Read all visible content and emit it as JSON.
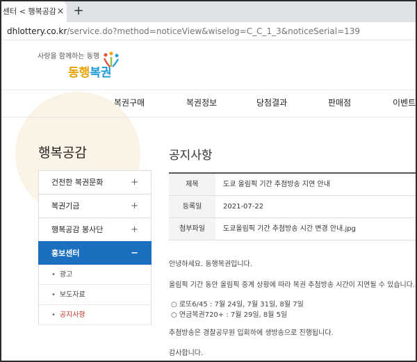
{
  "browser": {
    "tab_title": "센터 < 행복공감",
    "tab_close": "×",
    "new_tab": "+",
    "url_host": "dhlottery.co.kr",
    "url_path": "/service.do?method=noticeView&wiselog=C_C_1_3&noticeSerial=139"
  },
  "header": {
    "tagline": "사랑을 함께하는 동행",
    "logo_part1": "동행",
    "logo_part2": "복권",
    "nav": [
      "복권구매",
      "복권정보",
      "당첨결과",
      "판매점",
      "이벤트"
    ]
  },
  "sidebar": {
    "title": "행복공감",
    "items": [
      {
        "label": "건전한 복권문화",
        "toggle": "+"
      },
      {
        "label": "복권기금",
        "toggle": "+"
      },
      {
        "label": "행복공감 봉사단",
        "toggle": "+"
      },
      {
        "label": "홍보센터",
        "toggle": "−"
      }
    ],
    "subitems": [
      {
        "bullet": "•",
        "label": "광고"
      },
      {
        "bullet": "•",
        "label": "보도자료"
      },
      {
        "bullet": "•",
        "label": "공지사항"
      }
    ]
  },
  "notice": {
    "section_title": "공지사항",
    "rows": [
      {
        "label": "제목",
        "value": "도쿄 올림픽 기간 추첨방송 지연 안내"
      },
      {
        "label": "등록일",
        "value": "2021-07-22"
      },
      {
        "label": "첨부파일",
        "value": "도쿄올림픽 기간 추첨방송 시간 변경 안내.jpg"
      }
    ],
    "body": [
      "안녕하세요. 동행복권입니다.",
      "올림픽 기간 동안 올림픽 중계 상황에 따라 복권 추첨방송 시간이 지연될 수 있습니다.",
      "○ 로또6/45 : 7월 24일, 7월 31일, 8월 7일",
      "○ 연금복권720+ : 7월 29일, 8월 5일",
      "추첨방송은 경찰공무원 입회하에 생방송으로 진행됩니다.",
      "감사합니다."
    ]
  }
}
